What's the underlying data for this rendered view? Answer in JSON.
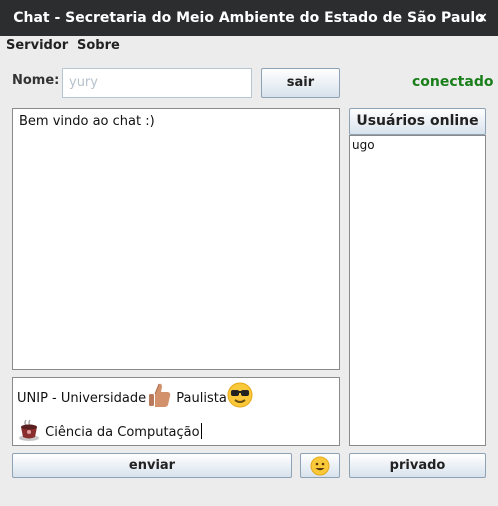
{
  "window": {
    "title": "Chat - Secretaria do Meio Ambiente do Estado de São Paulo",
    "close_glyph": "×"
  },
  "menu": {
    "items": [
      "Servidor",
      "Sobre"
    ]
  },
  "login": {
    "label": "Nome:",
    "name_placeholder": "yury",
    "exit_label": "sair",
    "status": "conectado"
  },
  "chat": {
    "messages": "Bem vindo ao chat :)"
  },
  "users": {
    "header": "Usuários online",
    "items": [
      "ugo"
    ]
  },
  "compose": {
    "line1_a": "UNIP - Universidade",
    "line1_b": "Paulista",
    "line2": "Ciência da Computação"
  },
  "actions": {
    "send_label": "enviar",
    "emoji_icon": "smiley-emoji-icon",
    "private_label": "privado"
  },
  "colors": {
    "title_bar": "#2b2d2e",
    "status_green": "#1a7f1a",
    "button_border": "#8ea2b5"
  }
}
